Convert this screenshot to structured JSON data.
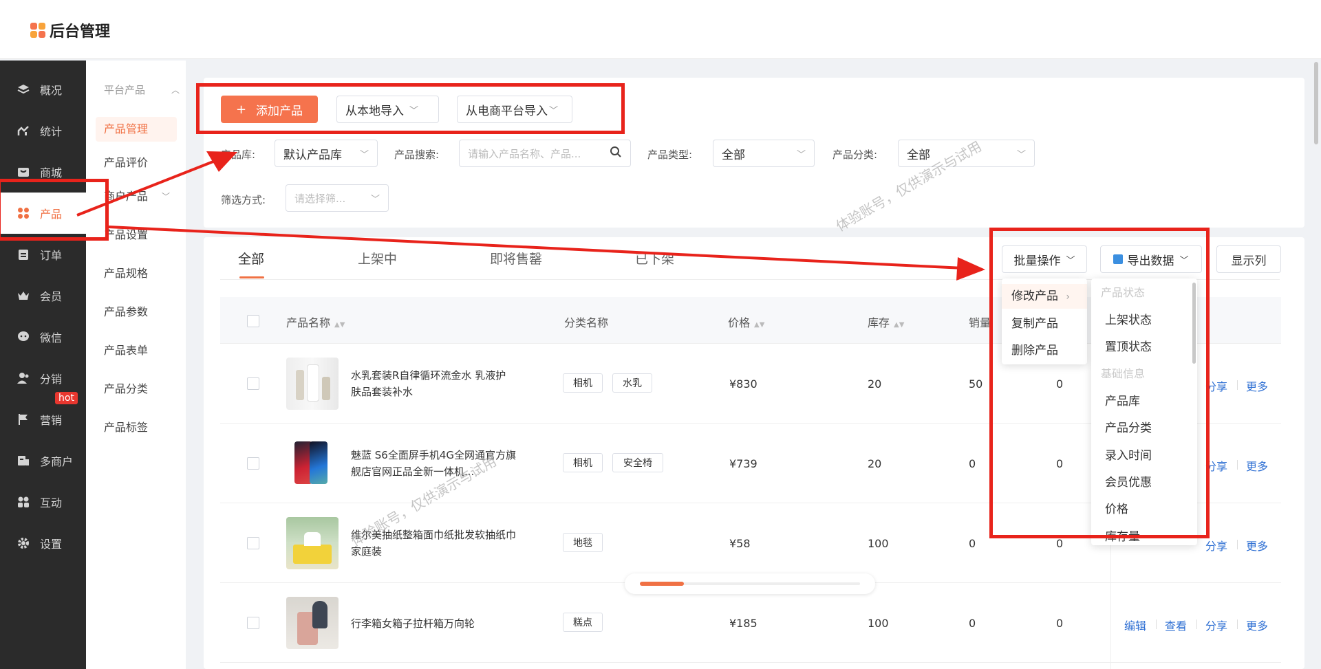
{
  "app": {
    "title": "后台管理"
  },
  "nav": {
    "items": [
      {
        "label": "概况",
        "icon": "layers-icon"
      },
      {
        "label": "统计",
        "icon": "chart-icon"
      },
      {
        "label": "商城",
        "icon": "store-icon"
      },
      {
        "label": "产品",
        "icon": "apps-icon",
        "active": true
      },
      {
        "label": "订单",
        "icon": "clipboard-icon"
      },
      {
        "label": "会员",
        "icon": "crown-icon"
      },
      {
        "label": "微信",
        "icon": "chat-icon"
      },
      {
        "label": "分销",
        "icon": "users-icon"
      },
      {
        "label": "营销",
        "icon": "flag-icon",
        "badge": "hot"
      },
      {
        "label": "多商户",
        "icon": "merchant-icon"
      },
      {
        "label": "互动",
        "icon": "interact-icon"
      },
      {
        "label": "设置",
        "icon": "gear-icon"
      }
    ]
  },
  "subnav": {
    "group_label": "平台产品",
    "items": [
      "产品管理",
      "产品评价",
      "商户产品",
      "产品设置",
      "产品规格",
      "产品参数",
      "产品表单",
      "产品分类",
      "产品标签"
    ]
  },
  "toolbar": {
    "add_label": "添加产品",
    "import_local_label": "从本地导入",
    "import_ecom_label": "从电商平台导入"
  },
  "filters": {
    "library_label": "产品库:",
    "library_value": "默认产品库",
    "search_label": "产品搜索:",
    "search_placeholder": "请输入产品名称、产品...",
    "type_label": "产品类型:",
    "type_value": "全部",
    "category_label": "产品分类:",
    "category_value": "全部",
    "filter_label": "筛选方式:",
    "filter_placeholder": "请选择筛..."
  },
  "tabs": [
    "全部",
    "上架中",
    "即将售罄",
    "已下架"
  ],
  "actions": {
    "batch_label": "批量操作",
    "export_label": "导出数据",
    "columns_label": "显示列"
  },
  "table": {
    "columns": [
      "产品名称",
      "分类名称",
      "价格",
      "库存",
      "销量"
    ],
    "rows": [
      {
        "name": "水乳套装R自律循环流金水 乳液护肤品套装补水",
        "tags": [
          "相机",
          "水乳"
        ],
        "price": "¥830",
        "stock": "20",
        "sales": "50",
        "extra": "0"
      },
      {
        "name": "魅蓝 S6全面屏手机4G全网通官方旗舰店官网正品全新一体机...",
        "tags": [
          "相机",
          "安全椅"
        ],
        "price": "¥739",
        "stock": "20",
        "sales": "0",
        "extra": "0"
      },
      {
        "name": "维尔美抽纸整箱面巾纸批发软抽纸巾家庭装",
        "tags": [
          "地毯"
        ],
        "price": "¥58",
        "stock": "100",
        "sales": "0",
        "extra": "0"
      },
      {
        "name": "行李箱女箱子拉杆箱万向轮",
        "tags": [
          "糕点"
        ],
        "price": "¥185",
        "stock": "100",
        "sales": "0",
        "extra": "0"
      }
    ],
    "row_actions": [
      "编辑",
      "查看",
      "分享",
      "更多"
    ]
  },
  "batch_menu": {
    "items": [
      "修改产品",
      "复制产品",
      "删除产品"
    ]
  },
  "sub_menu": {
    "group1": "产品状态",
    "group1_items": [
      "上架状态",
      "置顶状态"
    ],
    "group2": "基础信息",
    "group2_items": [
      "产品库",
      "产品分类",
      "录入时间",
      "会员优惠",
      "价格",
      "库存量"
    ]
  },
  "watermark": "体验账号，仅供演示与试用",
  "colors": {
    "accent": "#f07144",
    "annotation": "#e8231b",
    "link": "#2e6fd3",
    "nav_bg": "#2b2b2b"
  }
}
